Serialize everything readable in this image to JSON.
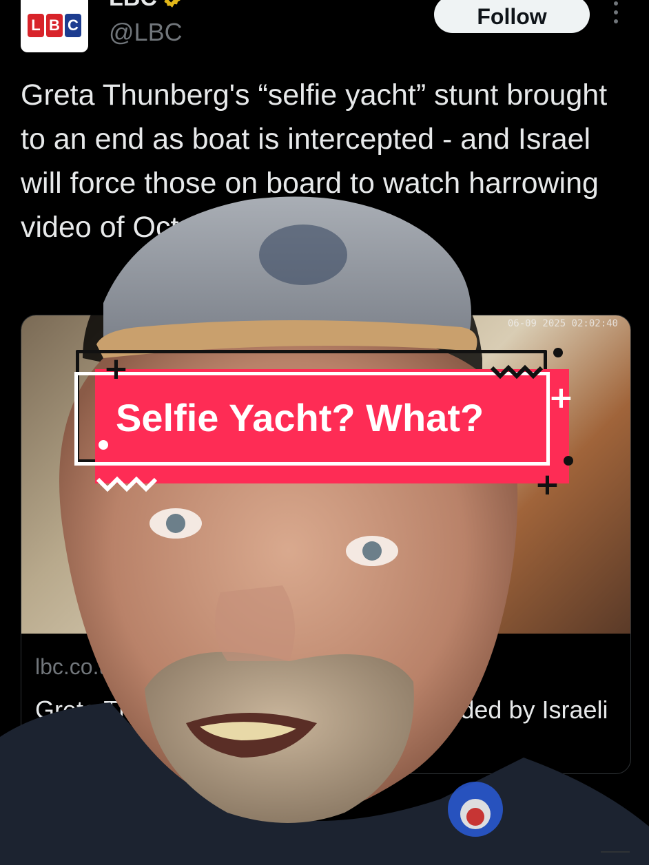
{
  "account": {
    "name": "LBC",
    "handle": "@LBC",
    "logo_letters": [
      "L",
      "B",
      "C"
    ],
    "verified_icon": "verified-badge-icon",
    "follow_label": "Follow",
    "more_icon": "more-vertical-icon"
  },
  "tweet": {
    "text": "Greta Thunberg's “selfie yacht” stunt brought to an end as boat is intercepted - and Israel will force those on board to watch harrowing video of October 7"
  },
  "link_card": {
    "timestamp": "06-09 2025 02:02:40",
    "domain": "lbc.co.uk",
    "title": "Greta Thunberg 'Freedom Flotilla' boarded by Israeli forces as she claims she’s..."
  },
  "overlay": {
    "caption": "Selfie Yacht? What?"
  },
  "colors": {
    "background": "#000000",
    "caption_bg": "#fe2c55",
    "follow_bg": "#eff3f4",
    "verified": "#e2b719",
    "logo_red": "#d8232a",
    "logo_blue": "#1d3c8f"
  }
}
